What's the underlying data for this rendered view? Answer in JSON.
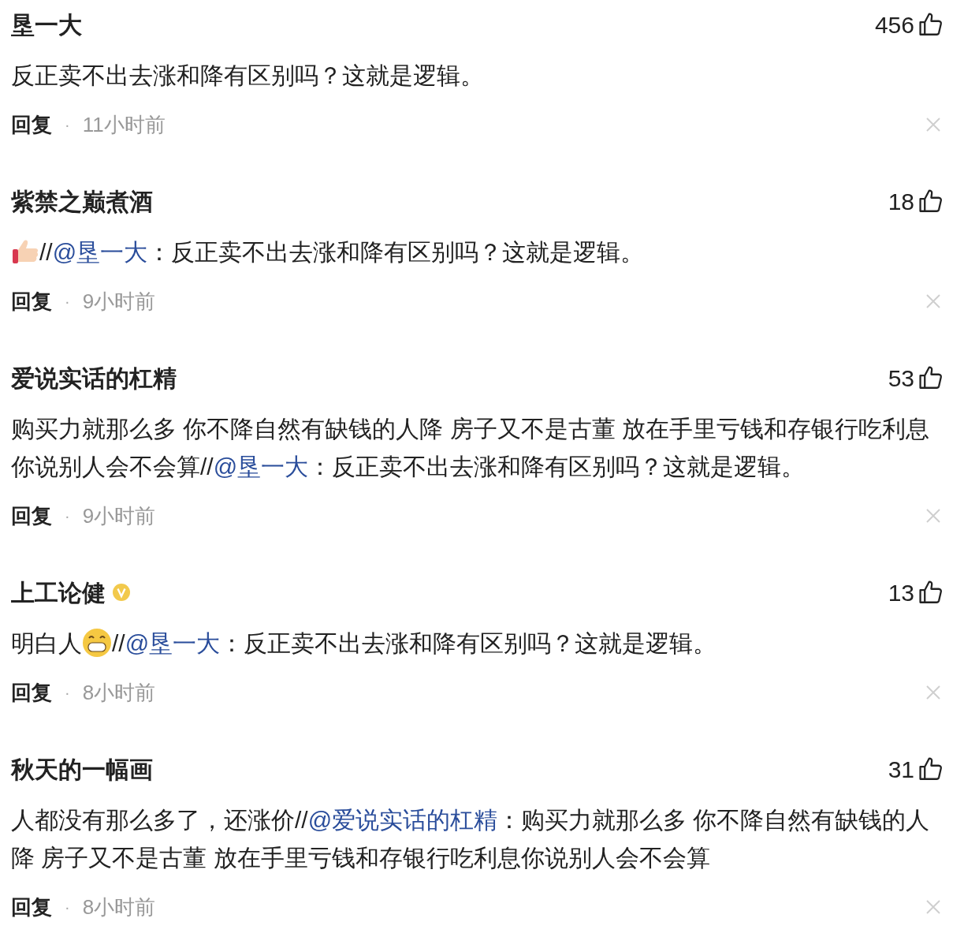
{
  "comments": [
    {
      "name": "垦一大",
      "verified": false,
      "likes": "456",
      "body": [
        {
          "kind": "text",
          "text": "反正卖不出去涨和降有区别吗？这就是逻辑。"
        }
      ],
      "reply": "回复",
      "separator": "·",
      "time": "11小时前"
    },
    {
      "name": "紫禁之巅煮酒",
      "verified": false,
      "likes": "18",
      "body": [
        {
          "kind": "thumbs_emoji"
        },
        {
          "kind": "text",
          "text": "//"
        },
        {
          "kind": "mention",
          "text": "@垦一大"
        },
        {
          "kind": "text",
          "text": "：反正卖不出去涨和降有区别吗？这就是逻辑。"
        }
      ],
      "reply": "回复",
      "separator": "·",
      "time": "9小时前"
    },
    {
      "name": "爱说实话的杠精",
      "verified": false,
      "likes": "53",
      "body": [
        {
          "kind": "text",
          "text": "购买力就那么多 你不降自然有缺钱的人降 房子又不是古董 放在手里亏钱和存银行吃利息你说别人会不会算//"
        },
        {
          "kind": "mention",
          "text": "@垦一大"
        },
        {
          "kind": "text",
          "text": "：反正卖不出去涨和降有区别吗？这就是逻辑。"
        }
      ],
      "reply": "回复",
      "separator": "·",
      "time": "9小时前"
    },
    {
      "name": "上工论健",
      "verified": true,
      "likes": "13",
      "body": [
        {
          "kind": "text",
          "text": "明白人"
        },
        {
          "kind": "grin_emoji"
        },
        {
          "kind": "text",
          "text": "//"
        },
        {
          "kind": "mention",
          "text": "@垦一大"
        },
        {
          "kind": "text",
          "text": "：反正卖不出去涨和降有区别吗？这就是逻辑。"
        }
      ],
      "reply": "回复",
      "separator": "·",
      "time": "8小时前"
    },
    {
      "name": "秋天的一幅画",
      "verified": false,
      "likes": "31",
      "body": [
        {
          "kind": "text",
          "text": "人都没有那么多了，还涨价//"
        },
        {
          "kind": "mention",
          "text": "@爱说实话的杠精"
        },
        {
          "kind": "text",
          "text": "：购买力就那么多 你不降自然有缺钱的人降 房子又不是古董 放在手里亏钱和存银行吃利息你说别人会不会算"
        }
      ],
      "reply": "回复",
      "separator": "·",
      "time": "8小时前"
    }
  ]
}
